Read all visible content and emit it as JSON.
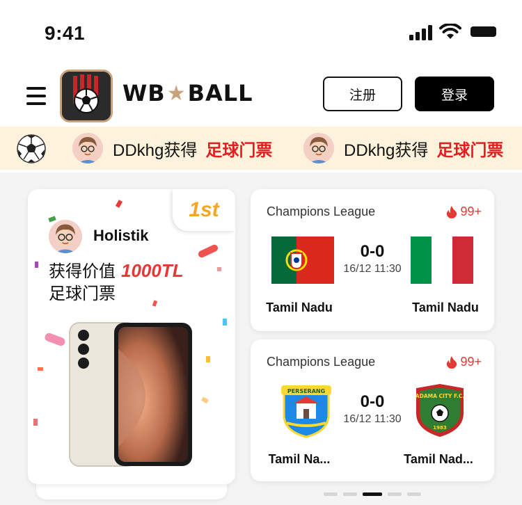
{
  "status_bar": {
    "time": "9:41"
  },
  "header": {
    "logo_text_left": "WB",
    "logo_text_right": "BALL",
    "register_label": "注册",
    "login_label": "登录"
  },
  "ticker": {
    "items": [
      {
        "user": "DDkhg获得",
        "prize": "足球门票"
      },
      {
        "user": "DDkhg获得",
        "prize": "足球门票"
      }
    ]
  },
  "prize_card": {
    "rank": "1st",
    "winner": "Holistik",
    "line1_prefix": "获得价值",
    "value": "1000TL",
    "line2": "足球门票"
  },
  "matches": [
    {
      "league": "Champions League",
      "hot": "99+",
      "score": "0-0",
      "time": "16/12 11:30",
      "home": "Tamil Nadu",
      "away": "Tamil Nadu"
    },
    {
      "league": "Champions League",
      "hot": "99+",
      "score": "0-0",
      "time": "16/12 11:30",
      "home": "Tamil Na...",
      "away": "Tamil Nad...",
      "home_crest_text": "PERSERANG",
      "away_crest_text": "ADAMA CITY F.C.",
      "away_crest_year": "1983"
    }
  ],
  "pagination": {
    "count": 5,
    "active_index": 2
  },
  "colors": {
    "accent_red": "#e53935",
    "gold": "#f5a623",
    "ticker_bg": "#fdf2dc"
  }
}
